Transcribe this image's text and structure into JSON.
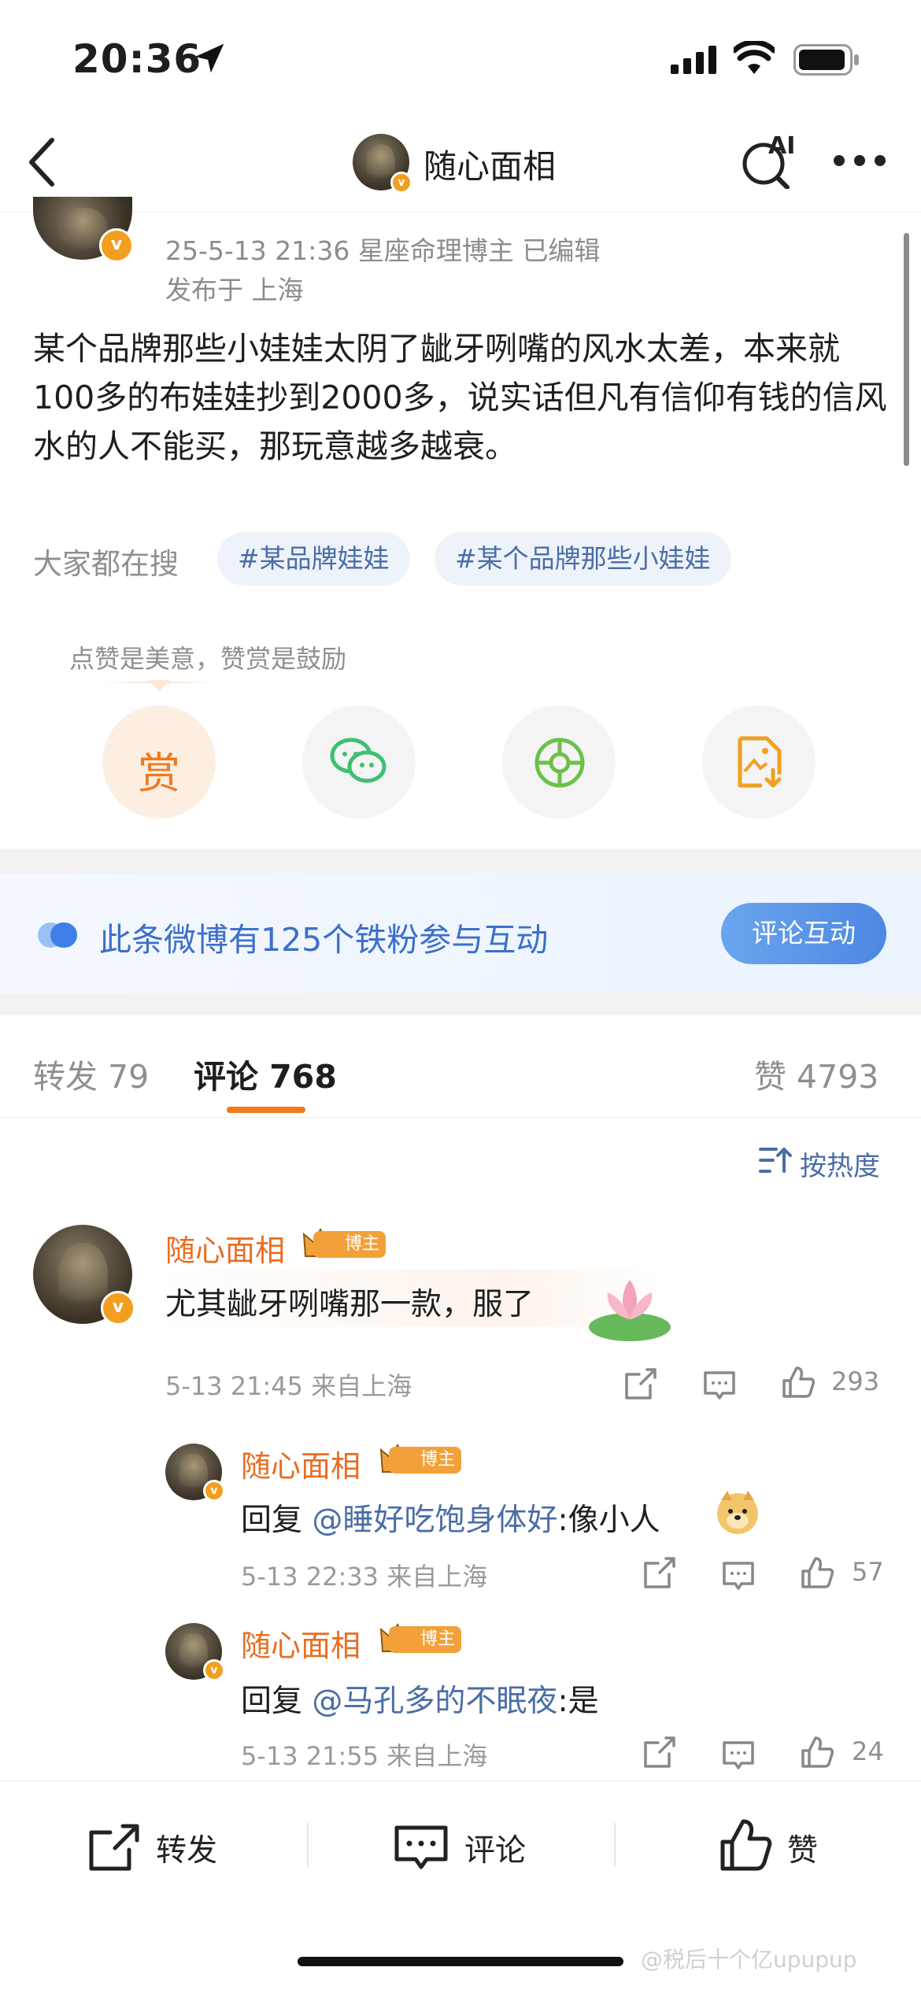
{
  "status_bar": {
    "time": "20:36"
  },
  "header": {
    "title": "随心面相",
    "ai_label": "AI"
  },
  "post": {
    "meta_line1": "25-5-13 21:36  星座命理博主  已编辑",
    "meta_line2": "发布于 上海",
    "text": "某个品牌那些小娃娃太阴了龇牙咧嘴的风水太差，本来就100多的布娃娃抄到2000多，说实话但凡有信仰有钱的信风水的人不能买，那玩意越多越衰。",
    "search_label": "大家都在搜",
    "tags": [
      "#某品牌娃娃",
      "#某个品牌那些小娃娃"
    ],
    "reward_tip": "点赞是美意，赞赏是鼓励",
    "reward_label": "赏"
  },
  "banner": {
    "text": "此条微博有125个铁粉参与互动",
    "button": "评论互动"
  },
  "tabs": {
    "repost_label": "转发",
    "repost_count": "79",
    "comment_label": "评论",
    "comment_count": "768",
    "like_label": "赞",
    "like_count": "4793"
  },
  "sort": {
    "label": "按热度"
  },
  "comments": [
    {
      "name": "随心面相",
      "badge": "博主",
      "text": "尤其龇牙咧嘴那一款，服了",
      "time": "5-13 21:45",
      "location": "来自上海",
      "likes": "293"
    },
    {
      "name": "随心面相",
      "badge": "博主",
      "reply_prefix": "回复",
      "mention": "@睡好吃饱身体好",
      "text": ":像小人",
      "time": "5-13 22:33",
      "location": "来自上海",
      "likes": "57"
    },
    {
      "name": "随心面相",
      "badge": "博主",
      "reply_prefix": "回复",
      "mention": "@马孔多的不眠夜",
      "text": ":是",
      "time": "5-13 21:55",
      "location": "来自上海",
      "likes": "24"
    }
  ],
  "bottom_bar": {
    "repost": "转发",
    "comment": "评论",
    "like": "赞"
  },
  "watermark": "@税后十个亿upupup",
  "colors": {
    "accent": "#e96d22",
    "link": "#4a6da6",
    "banner_text": "#3d6fcb"
  }
}
